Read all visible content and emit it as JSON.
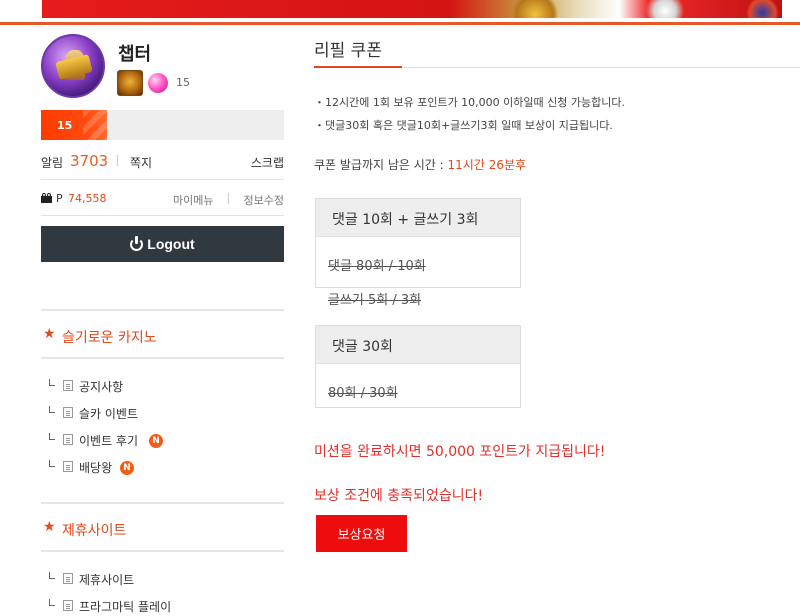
{
  "profile": {
    "nickname": "챕터",
    "level": "15",
    "xp_percent": 27
  },
  "alarm": {
    "label": "알림",
    "count": "3703",
    "memo_label": "쪽지",
    "scrap_label": "스크랩"
  },
  "points": {
    "label": "P",
    "value": "74,558",
    "mymenu_label": "마이메뉴",
    "edit_label": "정보수정"
  },
  "logout": {
    "label": "Logout"
  },
  "sections": [
    {
      "title": "슬기로운 카지노",
      "items": [
        {
          "label": "공지사항",
          "is_new": false
        },
        {
          "label": "슬카 이벤트",
          "is_new": false
        },
        {
          "label": "이벤트 후기",
          "is_new": true
        },
        {
          "label": "배당왕",
          "is_new": true
        }
      ]
    },
    {
      "title": "제휴사이트",
      "items": [
        {
          "label": "제휴사이트",
          "is_new": false
        },
        {
          "label": "프라그마틱 플레이",
          "is_new": false
        }
      ]
    }
  ],
  "new_badge": "N",
  "page": {
    "title": "리필 쿠폰",
    "notices": [
      "・12시간에 1회 보유 포인트가 10,000 이하일때 신청 가능합니다.",
      "・댓글30회 혹은 댓글10회+글쓰기3회 일때 보상이 지급됩니다."
    ],
    "remain_label": "쿠폰 발급까지 남은 시간 : ",
    "remain_value": "11시간 26분후",
    "box1": {
      "title": "댓글 10회 + 글쓰기 3회",
      "lines": [
        "댓글 80회 / 10회",
        "글쓰기 5회 / 3회"
      ]
    },
    "box2": {
      "title": "댓글 30회",
      "lines": [
        "80회 / 30회"
      ]
    },
    "mission_text": "미션을 완료하시면 50,000 포인트가 지급됩니다!",
    "fulfilled_text": "보상 조건에 충족되었습니다!",
    "reward_button": "보상요청"
  },
  "colors": {
    "accent": "#e2491b",
    "alert_red": "#e0302b",
    "button_red": "#ee0d0d",
    "logout_bg": "#303840"
  }
}
